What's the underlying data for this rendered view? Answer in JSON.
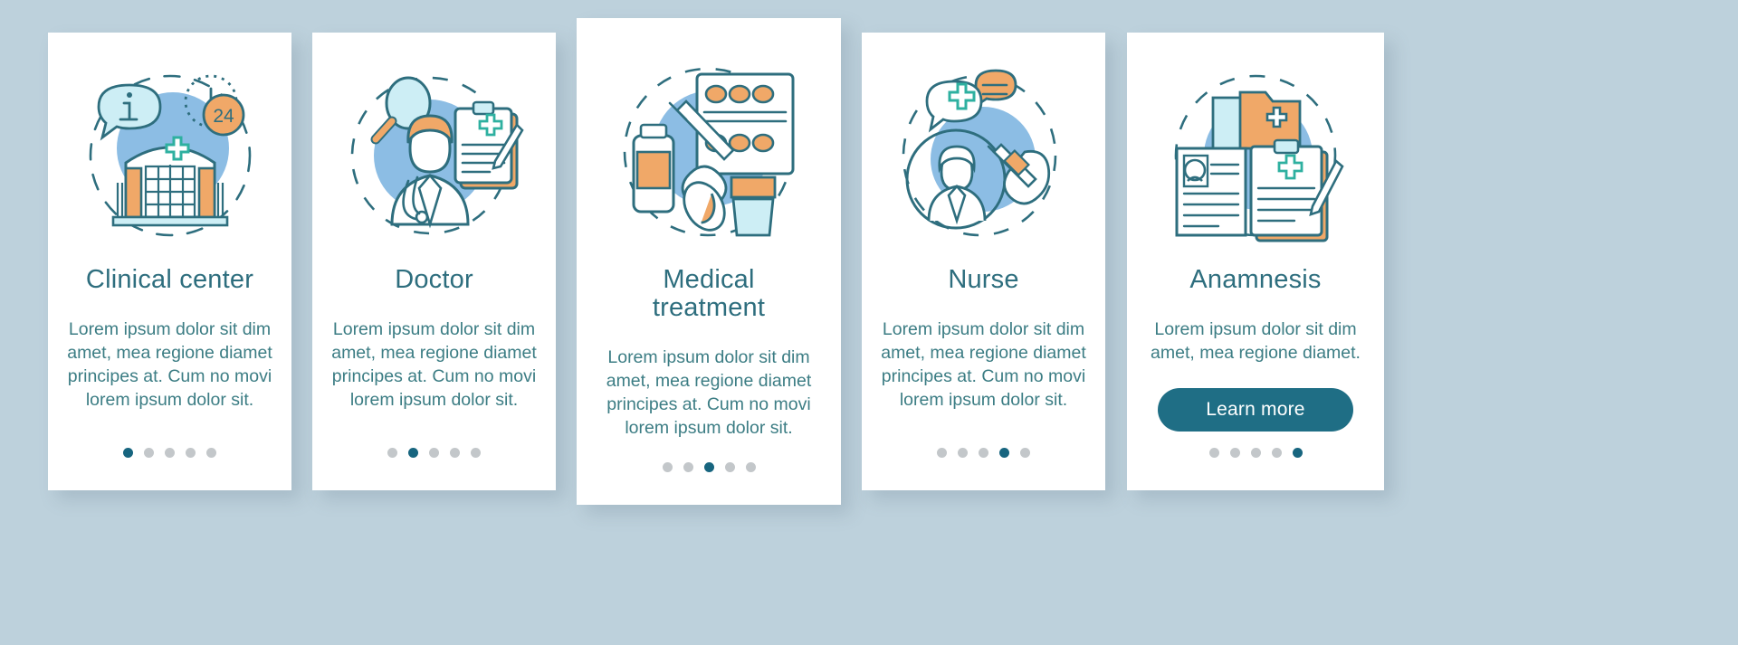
{
  "background_color": "#bdd1dc",
  "theme": {
    "title_color": "#2e6e7e",
    "body_color": "#3c7d84",
    "accent_teal": "#1f6e85",
    "accent_orange": "#f0a868",
    "accent_light_blue": "#8cbde4",
    "dot_inactive": "#c3c7ca",
    "dot_active": "#17657f",
    "card_background": "#ffffff"
  },
  "cards": [
    {
      "id": "clinical-center",
      "icon": "hospital-building-icon",
      "title": "Clinical center",
      "body": "Lorem ipsum dolor sit dim amet, mea regione diamet principes at. Cum no movi lorem ipsum dolor sit.",
      "dots": {
        "count": 5,
        "active_index": 0
      },
      "button": null
    },
    {
      "id": "doctor",
      "icon": "doctor-icon",
      "title": "Doctor",
      "body": "Lorem ipsum dolor sit dim amet, mea regione diamet principes at. Cum no movi lorem ipsum dolor sit.",
      "dots": {
        "count": 5,
        "active_index": 1
      },
      "button": null
    },
    {
      "id": "medical-treatment",
      "icon": "medication-icon",
      "title": "Medical treatment",
      "title_line_1": "Medical",
      "title_line_2": "treatment",
      "body": "Lorem ipsum dolor sit dim amet, mea regione diamet principes at. Cum no movi lorem ipsum dolor sit.",
      "dots": {
        "count": 5,
        "active_index": 2
      },
      "button": null
    },
    {
      "id": "nurse",
      "icon": "nurse-icon",
      "title": "Nurse",
      "body": "Lorem ipsum dolor sit dim amet, mea regione diamet principes at. Cum no movi lorem ipsum dolor sit.",
      "dots": {
        "count": 5,
        "active_index": 3
      },
      "button": null
    },
    {
      "id": "anamnesis",
      "icon": "medical-records-icon",
      "title": "Anamnesis",
      "body": "Lorem ipsum dolor sit dim amet, mea regione diamet.",
      "dots": {
        "count": 5,
        "active_index": 4
      },
      "button": "Learn more"
    }
  ],
  "badges": {
    "clock_24h": "24",
    "information_symbol": "i"
  }
}
